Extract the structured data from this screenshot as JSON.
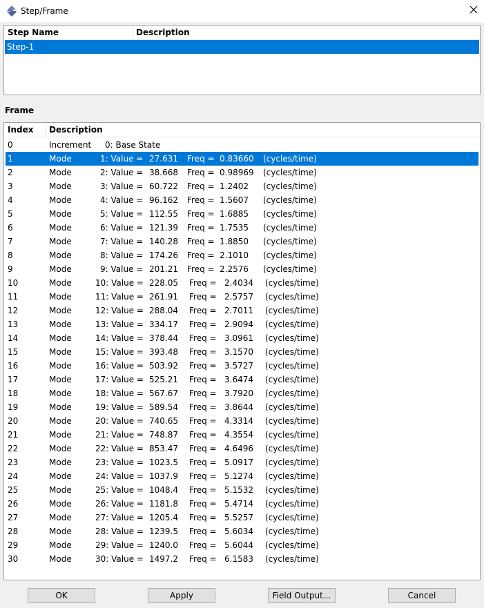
{
  "window": {
    "title": "Step/Frame"
  },
  "step_table": {
    "columns": [
      "Step Name",
      "Description"
    ],
    "rows": [
      {
        "name": "Step-1",
        "description": ""
      }
    ],
    "selected_index": 0
  },
  "frame_section": {
    "label": "Frame",
    "columns": [
      "Index",
      "Description"
    ],
    "selected_index": 1,
    "rows": [
      {
        "index": "0",
        "kind": "Increment",
        "label": "0: Base State",
        "value": "",
        "freq": "",
        "unit": ""
      },
      {
        "index": "1",
        "kind": "Mode",
        "label": "1: Value =",
        "value": "27.631",
        "freq": "0.83660",
        "unit": "(cycles/time)"
      },
      {
        "index": "2",
        "kind": "Mode",
        "label": "2: Value =",
        "value": "38.668",
        "freq": "0.98969",
        "unit": "(cycles/time)"
      },
      {
        "index": "3",
        "kind": "Mode",
        "label": "3: Value =",
        "value": "60.722",
        "freq": "1.2402",
        "unit": "(cycles/time)"
      },
      {
        "index": "4",
        "kind": "Mode",
        "label": "4: Value =",
        "value": "96.162",
        "freq": "1.5607",
        "unit": "(cycles/time)"
      },
      {
        "index": "5",
        "kind": "Mode",
        "label": "5: Value =",
        "value": "112.55",
        "freq": "1.6885",
        "unit": "(cycles/time)"
      },
      {
        "index": "6",
        "kind": "Mode",
        "label": "6: Value =",
        "value": "121.39",
        "freq": "1.7535",
        "unit": "(cycles/time)"
      },
      {
        "index": "7",
        "kind": "Mode",
        "label": "7: Value =",
        "value": "140.28",
        "freq": "1.8850",
        "unit": "(cycles/time)"
      },
      {
        "index": "8",
        "kind": "Mode",
        "label": "8: Value =",
        "value": "174.26",
        "freq": "2.1010",
        "unit": "(cycles/time)"
      },
      {
        "index": "9",
        "kind": "Mode",
        "label": "9: Value =",
        "value": "201.21",
        "freq": "2.2576",
        "unit": "(cycles/time)"
      },
      {
        "index": "10",
        "kind": "Mode",
        "label": "10: Value =",
        "value": "228.05",
        "freq": "2.4034",
        "unit": "(cycles/time)"
      },
      {
        "index": "11",
        "kind": "Mode",
        "label": "11: Value =",
        "value": "261.91",
        "freq": "2.5757",
        "unit": "(cycles/time)"
      },
      {
        "index": "12",
        "kind": "Mode",
        "label": "12: Value =",
        "value": "288.04",
        "freq": "2.7011",
        "unit": "(cycles/time)"
      },
      {
        "index": "13",
        "kind": "Mode",
        "label": "13: Value =",
        "value": "334.17",
        "freq": "2.9094",
        "unit": "(cycles/time)"
      },
      {
        "index": "14",
        "kind": "Mode",
        "label": "14: Value =",
        "value": "378.44",
        "freq": "3.0961",
        "unit": "(cycles/time)"
      },
      {
        "index": "15",
        "kind": "Mode",
        "label": "15: Value =",
        "value": "393.48",
        "freq": "3.1570",
        "unit": "(cycles/time)"
      },
      {
        "index": "16",
        "kind": "Mode",
        "label": "16: Value =",
        "value": "503.92",
        "freq": "3.5727",
        "unit": "(cycles/time)"
      },
      {
        "index": "17",
        "kind": "Mode",
        "label": "17: Value =",
        "value": "525.21",
        "freq": "3.6474",
        "unit": "(cycles/time)"
      },
      {
        "index": "18",
        "kind": "Mode",
        "label": "18: Value =",
        "value": "567.67",
        "freq": "3.7920",
        "unit": "(cycles/time)"
      },
      {
        "index": "19",
        "kind": "Mode",
        "label": "19: Value =",
        "value": "589.54",
        "freq": "3.8644",
        "unit": "(cycles/time)"
      },
      {
        "index": "20",
        "kind": "Mode",
        "label": "20: Value =",
        "value": "740.65",
        "freq": "4.3314",
        "unit": "(cycles/time)"
      },
      {
        "index": "21",
        "kind": "Mode",
        "label": "21: Value =",
        "value": "748.87",
        "freq": "4.3554",
        "unit": "(cycles/time)"
      },
      {
        "index": "22",
        "kind": "Mode",
        "label": "22: Value =",
        "value": "853.47",
        "freq": "4.6496",
        "unit": "(cycles/time)"
      },
      {
        "index": "23",
        "kind": "Mode",
        "label": "23: Value =",
        "value": "1023.5",
        "freq": "5.0917",
        "unit": "(cycles/time)"
      },
      {
        "index": "24",
        "kind": "Mode",
        "label": "24: Value =",
        "value": "1037.9",
        "freq": "5.1274",
        "unit": "(cycles/time)"
      },
      {
        "index": "25",
        "kind": "Mode",
        "label": "25: Value =",
        "value": "1048.4",
        "freq": "5.1532",
        "unit": "(cycles/time)"
      },
      {
        "index": "26",
        "kind": "Mode",
        "label": "26: Value =",
        "value": "1181.8",
        "freq": "5.4714",
        "unit": "(cycles/time)"
      },
      {
        "index": "27",
        "kind": "Mode",
        "label": "27: Value =",
        "value": "1205.4",
        "freq": "5.5257",
        "unit": "(cycles/time)"
      },
      {
        "index": "28",
        "kind": "Mode",
        "label": "28: Value =",
        "value": "1239.5",
        "freq": "5.6034",
        "unit": "(cycles/time)"
      },
      {
        "index": "29",
        "kind": "Mode",
        "label": "29: Value =",
        "value": "1240.0",
        "freq": "5.6044",
        "unit": "(cycles/time)"
      },
      {
        "index": "30",
        "kind": "Mode",
        "label": "30: Value =",
        "value": "1497.2",
        "freq": "6.1583",
        "unit": "(cycles/time)"
      }
    ],
    "freq_prefix": "Freq ="
  },
  "buttons": {
    "ok": "OK",
    "apply": "Apply",
    "field_output": "Field Output...",
    "cancel": "Cancel"
  },
  "colors": {
    "selection": "#0078d7",
    "window_bg": "#f0f0f0",
    "button_bg": "#e1e1e1"
  },
  "icons": {
    "app": "step-frame-app-icon",
    "close": "close-icon"
  }
}
